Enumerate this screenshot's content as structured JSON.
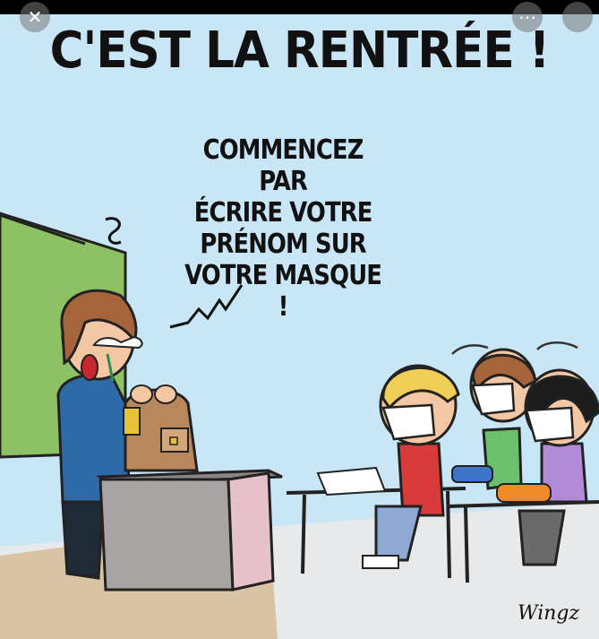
{
  "cartoon": {
    "title": "C'EST LA RENTRÉE !",
    "speech_lines": [
      "COMMENCEZ PAR",
      "ÉCRIRE VOTRE",
      "PRÉNOM SUR",
      "VOTRE MASQUE !"
    ],
    "signature": "Wingz"
  },
  "controls": {
    "close_symbol": "✕",
    "share_symbol": "⋯"
  },
  "colors": {
    "sky": "#c9e6f6",
    "wall_green": "#8cc164",
    "floor": "#d8c4a4",
    "teacher_shirt": "#2f6aa8",
    "desk": "#a9a4a4"
  }
}
